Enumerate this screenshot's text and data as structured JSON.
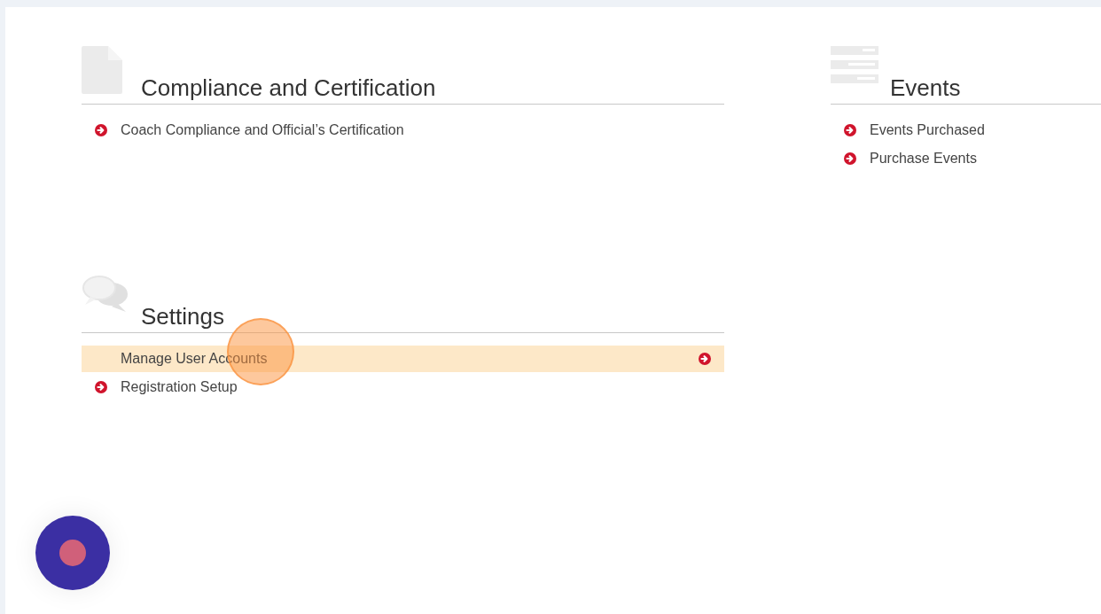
{
  "sections": [
    {
      "title": "Compliance and Certification",
      "kind": "document",
      "items": [
        {
          "label": "Coach Compliance and Official’s Certification",
          "hovered": false
        }
      ]
    },
    {
      "title": "Events",
      "kind": "list",
      "items": [
        {
          "label": "Events Purchased",
          "hovered": false
        },
        {
          "label": "Purchase Events",
          "hovered": false
        }
      ]
    },
    {
      "title": "Settings",
      "kind": "chat",
      "items": [
        {
          "label": "Manage User Accounts",
          "hovered": true
        },
        {
          "label": "Registration Setup",
          "hovered": false
        }
      ]
    }
  ]
}
